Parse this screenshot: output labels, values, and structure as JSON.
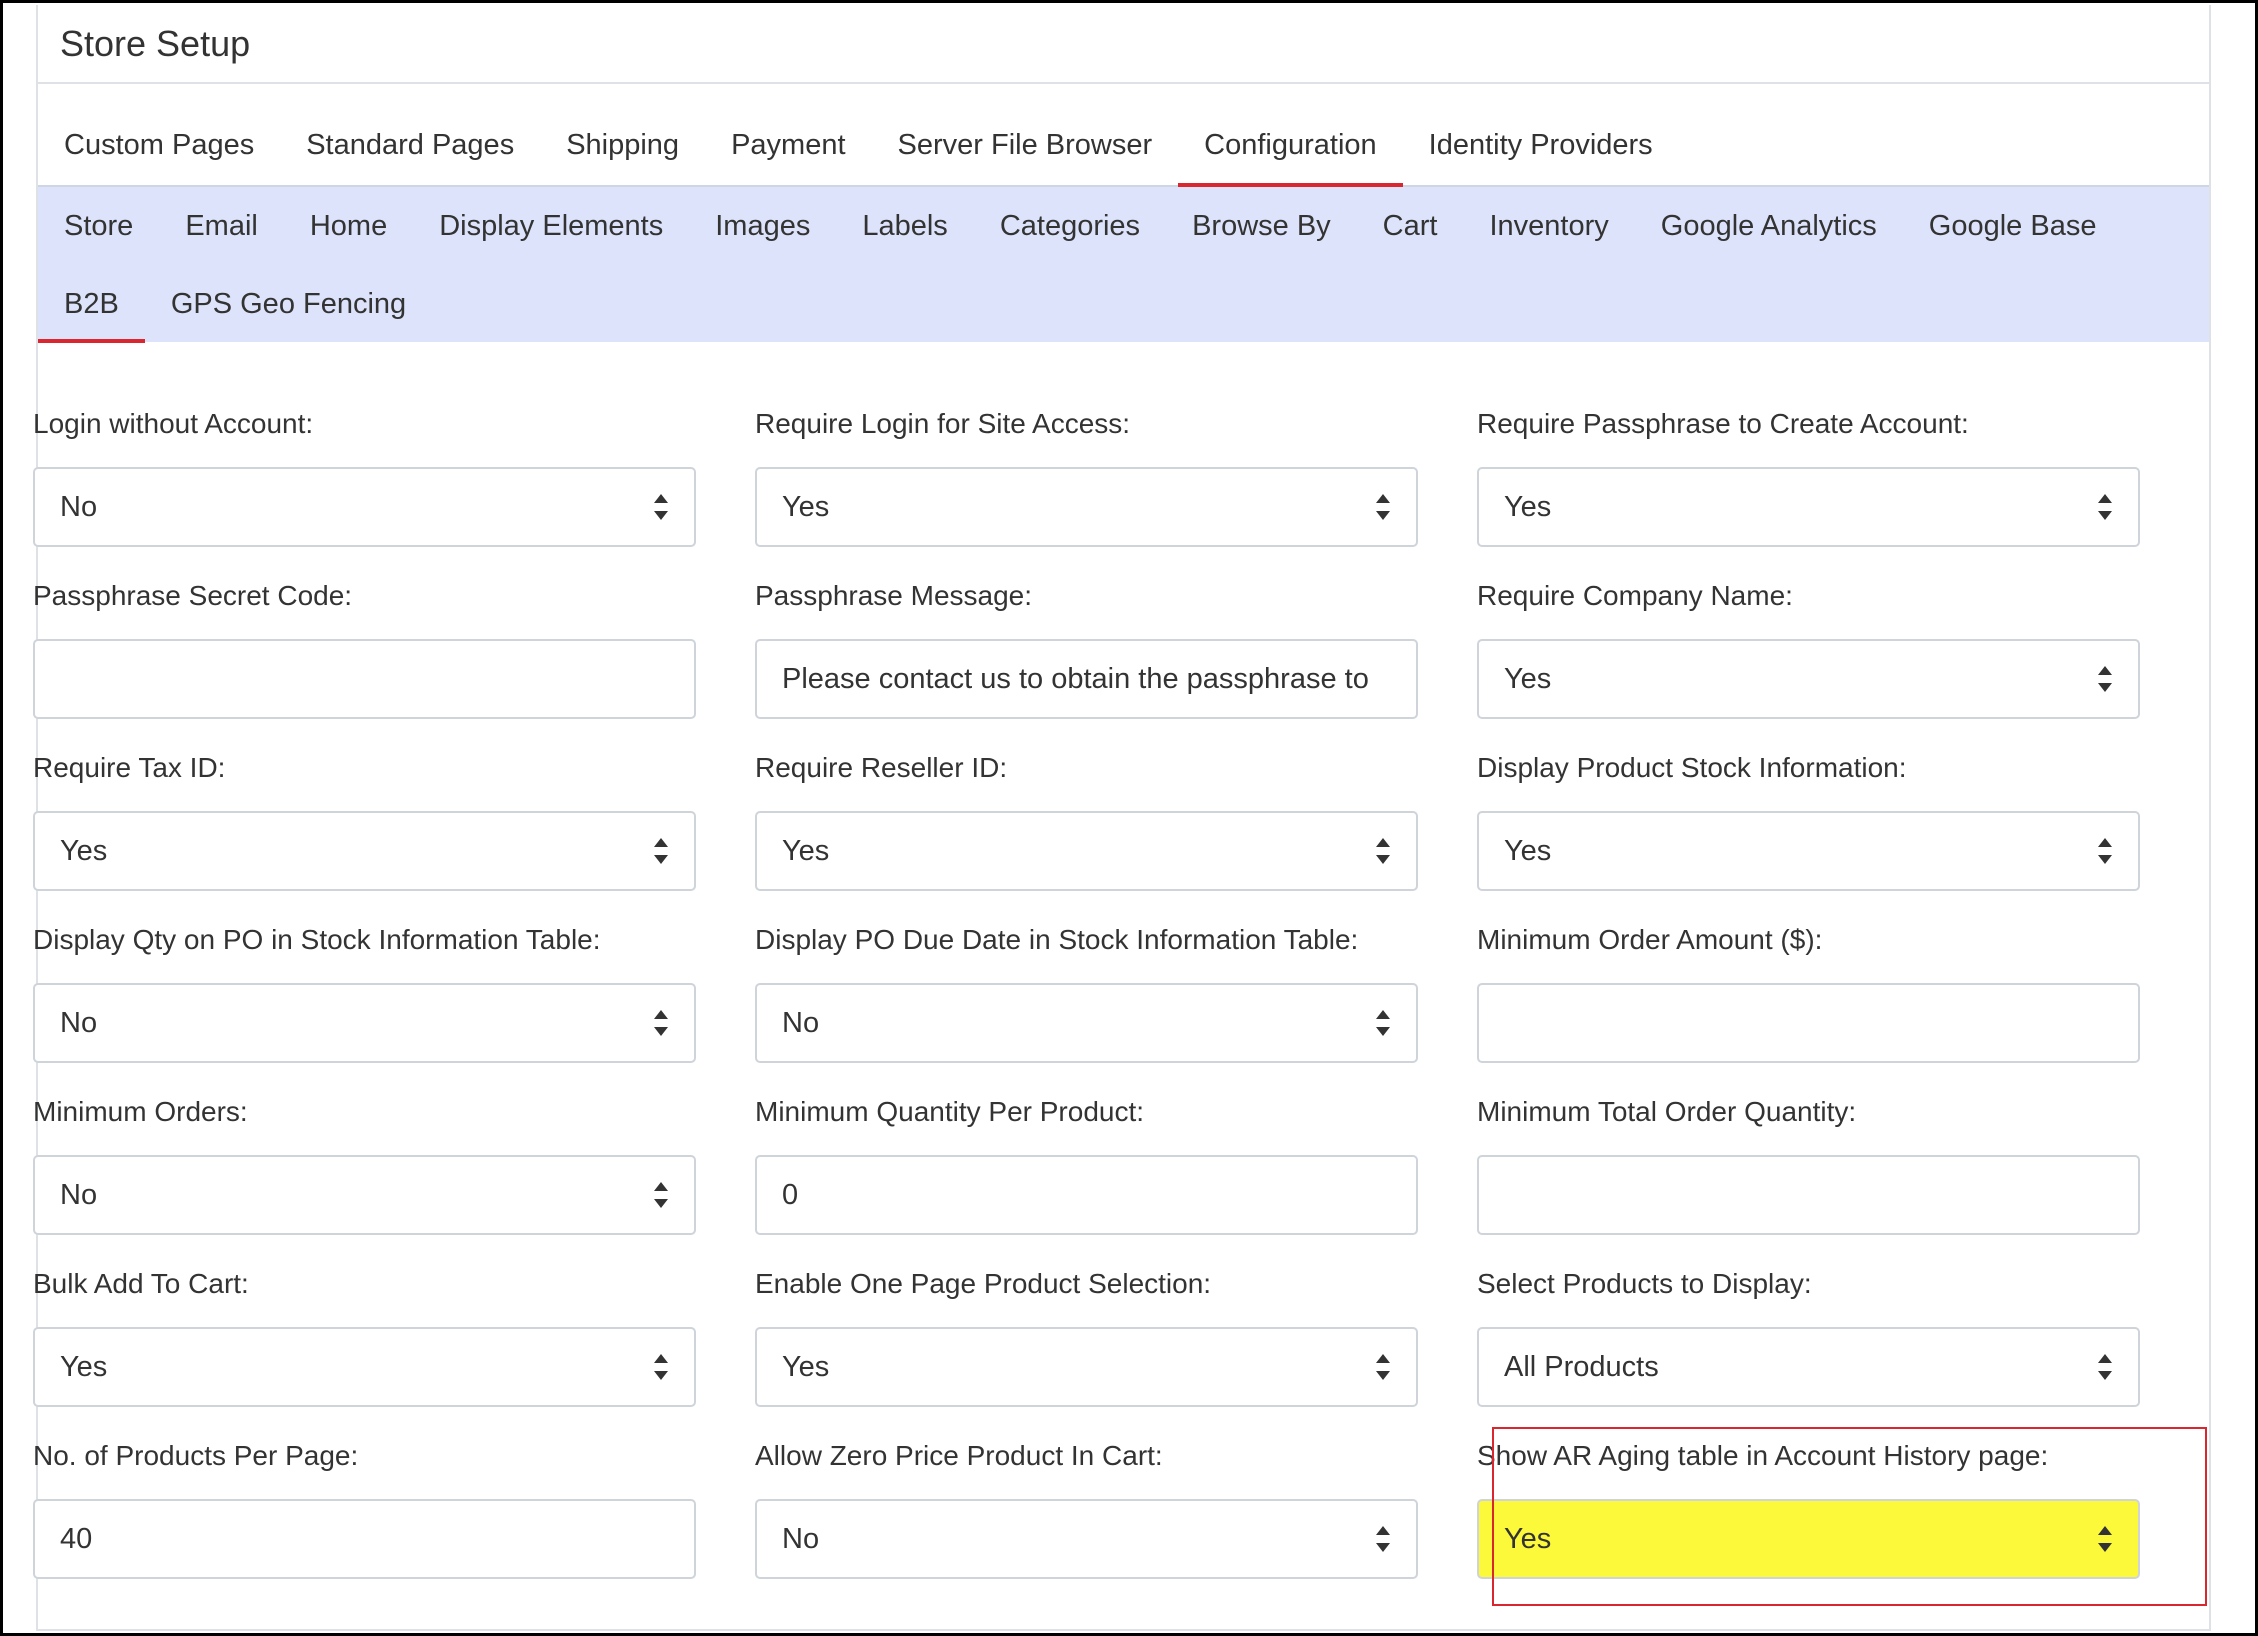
{
  "header": {
    "title": "Store Setup"
  },
  "main_tabs": [
    {
      "label": "Custom Pages",
      "active": false
    },
    {
      "label": "Standard Pages",
      "active": false
    },
    {
      "label": "Shipping",
      "active": false
    },
    {
      "label": "Payment",
      "active": false
    },
    {
      "label": "Server File Browser",
      "active": false
    },
    {
      "label": "Configuration",
      "active": true
    },
    {
      "label": "Identity Providers",
      "active": false
    }
  ],
  "sub_tabs": [
    {
      "label": "Store",
      "active": false
    },
    {
      "label": "Email",
      "active": false
    },
    {
      "label": "Home",
      "active": false
    },
    {
      "label": "Display Elements",
      "active": false
    },
    {
      "label": "Images",
      "active": false
    },
    {
      "label": "Labels",
      "active": false
    },
    {
      "label": "Categories",
      "active": false
    },
    {
      "label": "Browse By",
      "active": false
    },
    {
      "label": "Cart",
      "active": false
    },
    {
      "label": "Inventory",
      "active": false
    },
    {
      "label": "Google Analytics",
      "active": false
    },
    {
      "label": "Google Base",
      "active": false
    },
    {
      "label": "B2B",
      "active": true
    },
    {
      "label": "GPS Geo Fencing",
      "active": false
    }
  ],
  "fields": [
    {
      "label": "Login without Account:",
      "type": "select",
      "value": "No"
    },
    {
      "label": "Require Login for Site Access:",
      "type": "select",
      "value": "Yes"
    },
    {
      "label": "Require Passphrase to Create Account:",
      "type": "select",
      "value": "Yes"
    },
    {
      "label": "Passphrase Secret Code:",
      "type": "input",
      "value": ""
    },
    {
      "label": "Passphrase Message:",
      "type": "input",
      "value": "Please contact us to obtain the passphrase to"
    },
    {
      "label": "Require Company Name:",
      "type": "select",
      "value": "Yes"
    },
    {
      "label": "Require Tax ID:",
      "type": "select",
      "value": "Yes"
    },
    {
      "label": "Require Reseller ID:",
      "type": "select",
      "value": "Yes"
    },
    {
      "label": "Display Product Stock Information:",
      "type": "select",
      "value": "Yes"
    },
    {
      "label": "Display Qty on PO in Stock Information Table:",
      "type": "select",
      "value": "No"
    },
    {
      "label": "Display PO Due Date in Stock Information Table:",
      "type": "select",
      "value": "No"
    },
    {
      "label": "Minimum Order Amount ($):",
      "type": "input",
      "value": ""
    },
    {
      "label": "Minimum Orders:",
      "type": "select",
      "value": "No"
    },
    {
      "label": "Minimum Quantity Per Product:",
      "type": "input",
      "value": "0"
    },
    {
      "label": "Minimum Total Order Quantity:",
      "type": "input",
      "value": ""
    },
    {
      "label": "Bulk Add To Cart:",
      "type": "select",
      "value": "Yes"
    },
    {
      "label": "Enable One Page Product Selection:",
      "type": "select",
      "value": "Yes"
    },
    {
      "label": "Select Products to Display:",
      "type": "select",
      "value": "All Products"
    },
    {
      "label": "No. of Products Per Page:",
      "type": "input",
      "value": "40"
    },
    {
      "label": "Allow Zero Price Product In Cart:",
      "type": "select",
      "value": "No"
    },
    {
      "label": "Show AR Aging table in Account History page:",
      "type": "select",
      "value": "Yes",
      "highlighted": true
    }
  ],
  "colors": {
    "accent_underline": "#d9262f",
    "subnav_background": "#dce3fa",
    "highlight_fill": "#fcf83a",
    "annotation_box": "#d9262f"
  }
}
